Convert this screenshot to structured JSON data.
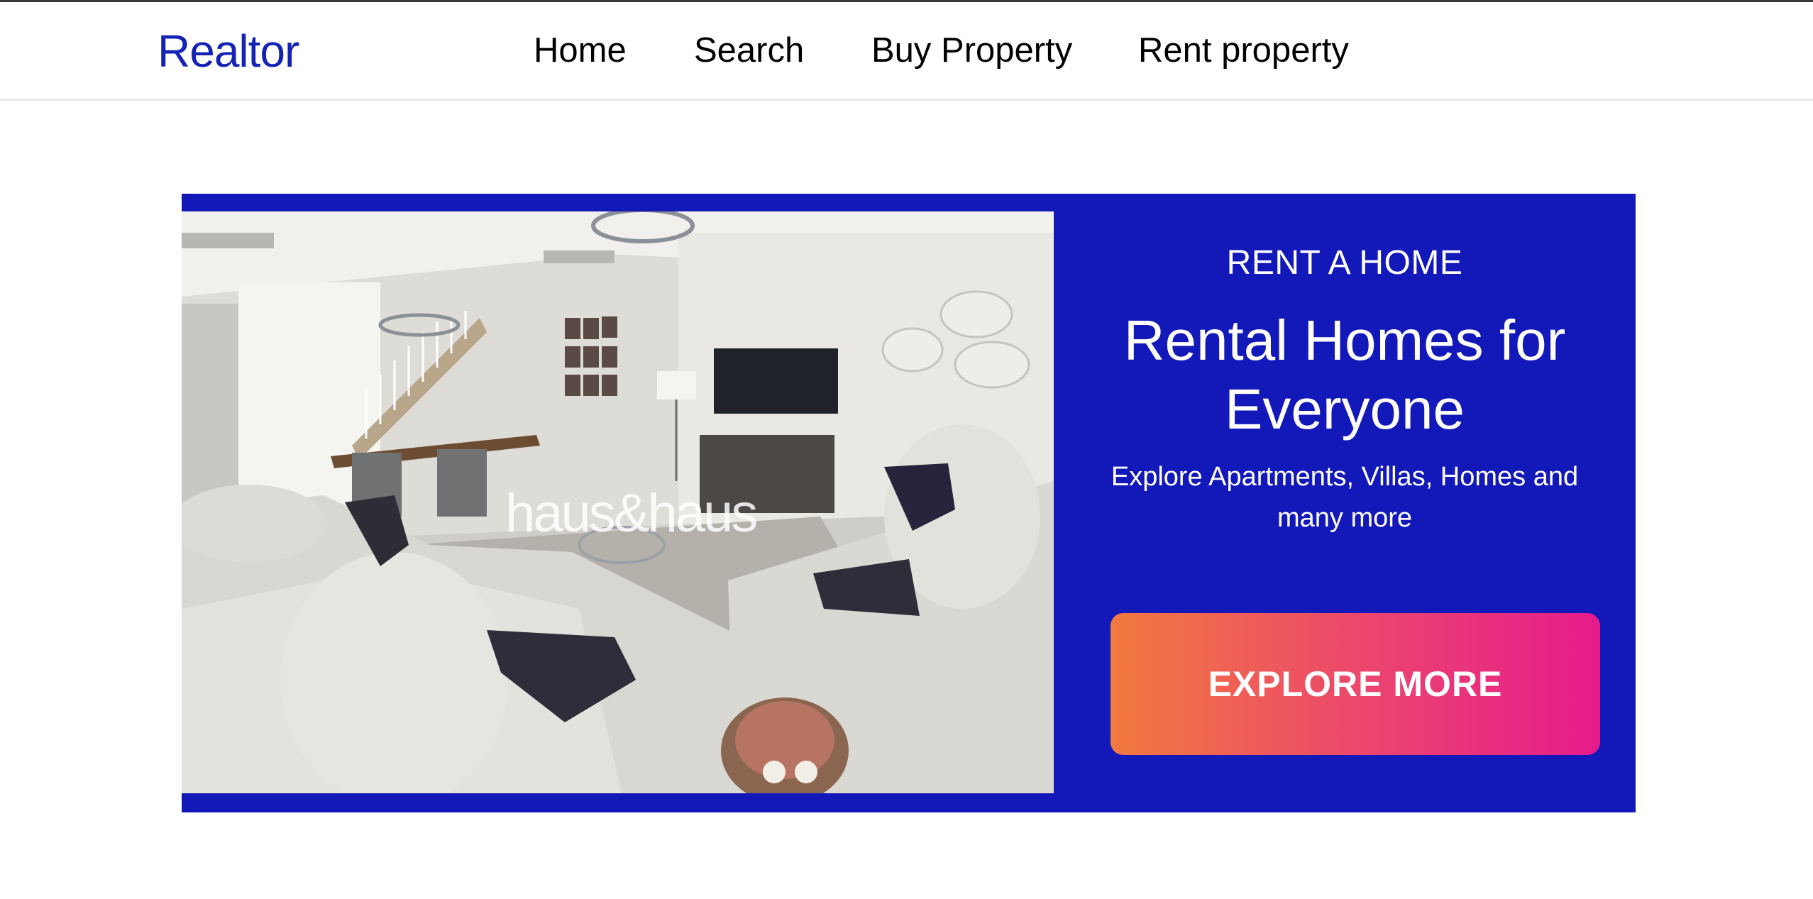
{
  "header": {
    "logo": "Realtor",
    "nav": [
      {
        "label": "Home"
      },
      {
        "label": "Search"
      },
      {
        "label": "Buy Property"
      },
      {
        "label": "Rent property"
      }
    ]
  },
  "hero": {
    "image_alt": "Living room interior",
    "watermark": "haus&haus",
    "eyebrow": "RENT A HOME",
    "title": "Rental Homes for Everyone",
    "subtitle": "Explore Apartments, Villas, Homes and many more",
    "cta_label": "EXPLORE MORE"
  },
  "colors": {
    "brand_blue": "#1319b8",
    "logo_blue": "#1423b5",
    "cta_gradient_start": "#f27a3e",
    "cta_gradient_end": "#e61b8c"
  }
}
